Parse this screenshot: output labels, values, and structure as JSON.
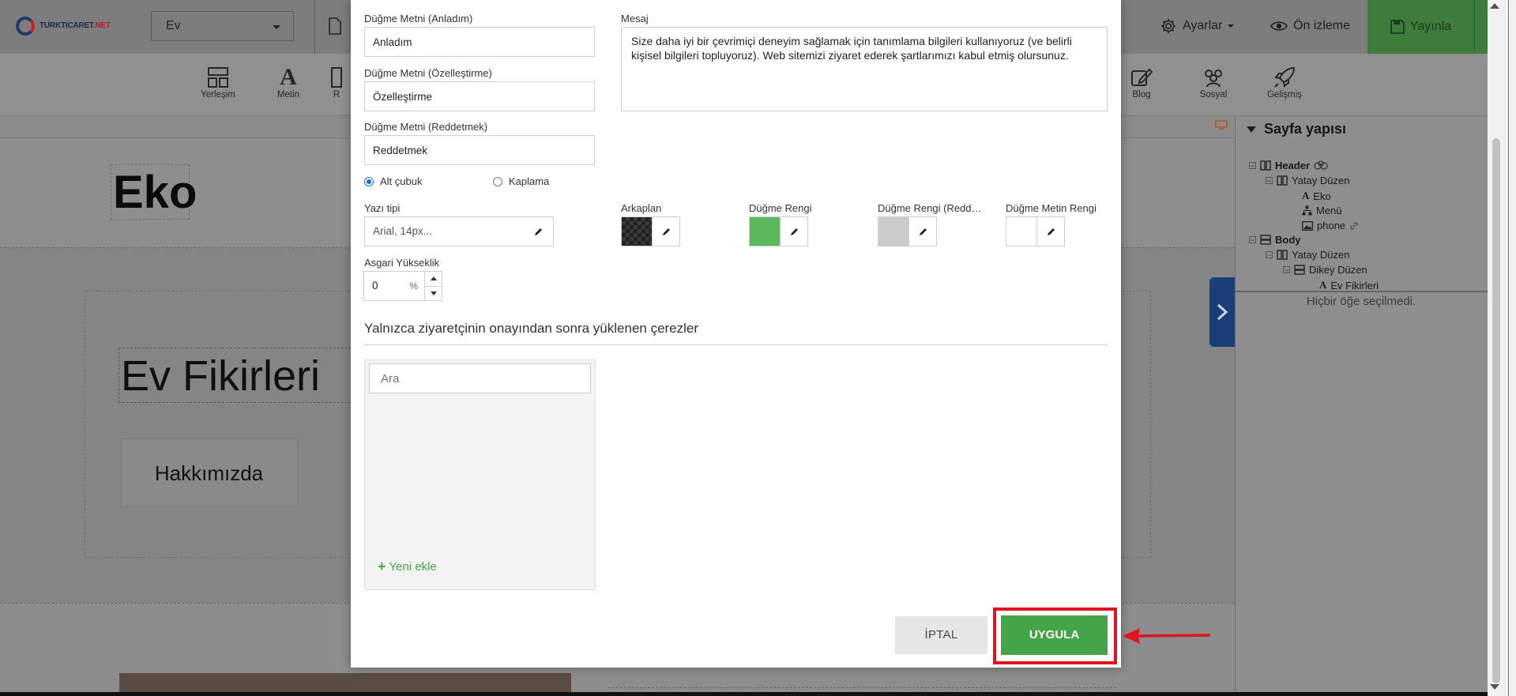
{
  "logo": {
    "text": "TURKTICARET",
    "net": ".NET"
  },
  "topbar": {
    "page_select": "Ev",
    "settings_label": "Ayarlar",
    "preview_label": "Ön izleme",
    "publish_label": "Yayınla"
  },
  "toolbar": {
    "items": [
      {
        "label": "Yerleşim",
        "icon": "layout-icon"
      },
      {
        "label": "Metin",
        "icon": "text-icon"
      },
      {
        "label": "R",
        "icon": "image-icon"
      },
      {
        "label": "Blog",
        "icon": "edit-icon"
      },
      {
        "label": "Sosyal",
        "icon": "people-icon"
      },
      {
        "label": "Gelişmiş",
        "icon": "rocket-icon"
      }
    ]
  },
  "canvas": {
    "header_text": "Eko",
    "hero_title": "Ev Fikirleri",
    "about_button": "Hakkımızda"
  },
  "panel": {
    "title": "Sayfa yapısı",
    "tree": [
      {
        "label": "Header",
        "level": 0
      },
      {
        "label": "Yatay Düzen",
        "level": 1
      },
      {
        "label": "Eko",
        "level": 2
      },
      {
        "label": "Menü",
        "level": 2
      },
      {
        "label": "phone",
        "level": 2
      },
      {
        "label": "Body",
        "level": 0
      },
      {
        "label": "Yatay Düzen",
        "level": 1
      },
      {
        "label": "Dikey Düzen",
        "level": 2
      },
      {
        "label": "Ev Fikirleri",
        "level": 3
      }
    ],
    "no_selection": "Hiçbir öğe seçilmedi."
  },
  "modal": {
    "btn_accept_label": "Düğme Metni (Anladım)",
    "btn_accept_value": "Anladım",
    "btn_custom_label": "Düğme Metni (Özelleştirme)",
    "btn_custom_value": "Özelleştirme",
    "btn_reject_label": "Düğme Metni (Reddetmek)",
    "btn_reject_value": "Reddetmek",
    "message_label": "Mesaj",
    "message_value": "Size daha iyi bir çevrimiçi deneyim sağlamak için tanımlama bilgileri kullanıyoruz (ve belirli kişisel bilgileri topluyoruz). Web sitemizi ziyaret ederek şartlarımızı kabul etmiş olursunuz.",
    "position_options": [
      {
        "label": "Alt çubuk",
        "selected": true
      },
      {
        "label": "Kaplama",
        "selected": false
      }
    ],
    "font_label": "Yazı tipi",
    "font_value": "Arial, 14px...",
    "bg_label": "Arkaplan",
    "btn_color_label": "Düğme Rengi",
    "btn_color_reject_label": "Düğme Rengi (Reddetmek)",
    "btn_text_color_label": "Düğme Metin Rengi",
    "colors": {
      "background": "#222222",
      "button": "#5cb85c",
      "button_reject": "#cccccc",
      "button_text": "#ffffff"
    },
    "min_height_label": "Asgari Yükseklik",
    "min_height_value": "0",
    "min_height_unit": "%",
    "cookies_title": "Yalnızca ziyaretçinin onayından sonra yüklenen çerezler",
    "search_placeholder": "Ara",
    "add_new": "Yeni ekle",
    "cancel": "İPTAL",
    "apply": "UYGULA"
  },
  "accent_colors": {
    "publish": "#3d7c3a",
    "apply": "#43a548",
    "highlight": "#e0141e",
    "panel_tab": "#1a3f78"
  }
}
